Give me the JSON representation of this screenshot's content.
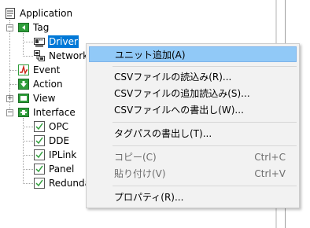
{
  "tree": {
    "root": "Application",
    "tag": "Tag",
    "driver": "Driver",
    "network": "Network",
    "event": "Event",
    "action": "Action",
    "view": "View",
    "interface": "Interface",
    "opc": "OPC",
    "dde": "DDE",
    "iplink": "IPLink",
    "panel": "Panel",
    "redundancy": "Redunda"
  },
  "menu": {
    "add_unit": "ユニット追加(A)",
    "load_csv": "CSVファイルの読込み(R)...",
    "append_csv": "CSVファイルの追加読込み(S)...",
    "write_csv": "CSVファイルへの書出し(W)...",
    "write_tagpath": "タグパスの書出し(T)...",
    "copy": "コピー(C)",
    "copy_key": "Ctrl+C",
    "paste": "貼り付け(V)",
    "paste_key": "Ctrl+V",
    "properties": "プロパティ(R)..."
  },
  "colors": {
    "selection": "#0078d7",
    "menu_highlight": "#91c9f7",
    "tree_icon_green": "#2e9d3a",
    "event_icon_red": "#cc2a1c"
  }
}
